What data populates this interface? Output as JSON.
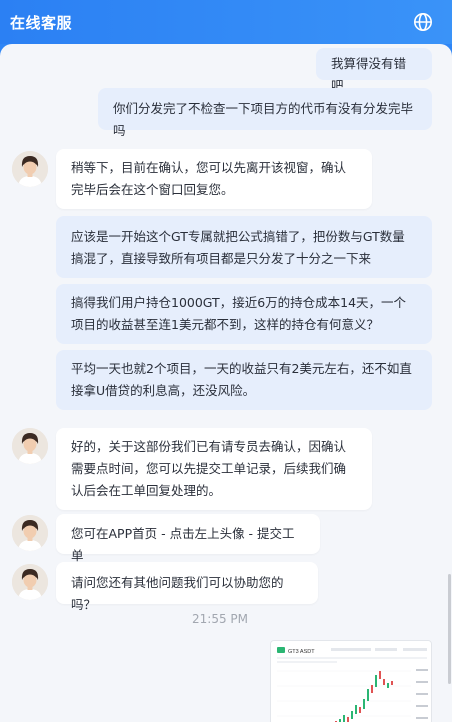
{
  "header": {
    "title": "在线客服",
    "globe_icon": "globe-icon"
  },
  "messages": [
    {
      "side": "right",
      "text": "我算得没有错吧"
    },
    {
      "side": "right",
      "text": "你们分发完了不检查一下项目方的代币有没有分发完毕吗"
    },
    {
      "side": "left",
      "text": "稍等下，目前在确认，您可以先离开该视窗，确认完毕后会在这个窗口回复您。"
    },
    {
      "side": "right",
      "text": "应该是一开始这个GT专属就把公式搞错了，把份数与GT数量搞混了，直接导致所有项目都是只分发了十分之一下来"
    },
    {
      "side": "right",
      "text": "搞得我们用户持仓1000GT，接近6万的持仓成本14天，一个项目的收益甚至连1美元都不到，这样的持仓有何意义？"
    },
    {
      "side": "right",
      "text": "平均一天也就2个项目，一天的收益只有2美元左右，还不如直接拿U借贷的利息高，还没风险。"
    },
    {
      "side": "left",
      "text": "好的，关于这部份我们已有请专员去确认，因确认需要点时间，您可以先提交工单记录，后续我们确认后会在工单回复处理的。"
    },
    {
      "side": "left",
      "text": "您可在APP首页 - 点击左上头像 - 提交工单"
    },
    {
      "side": "left",
      "text": "请问您还有其他问题我们可以协助您的吗？"
    }
  ],
  "timestamp": "21:55 PM",
  "attachment": {
    "label": "GT3 ASDT",
    "icon": "chart-screenshot-thumbnail"
  }
}
